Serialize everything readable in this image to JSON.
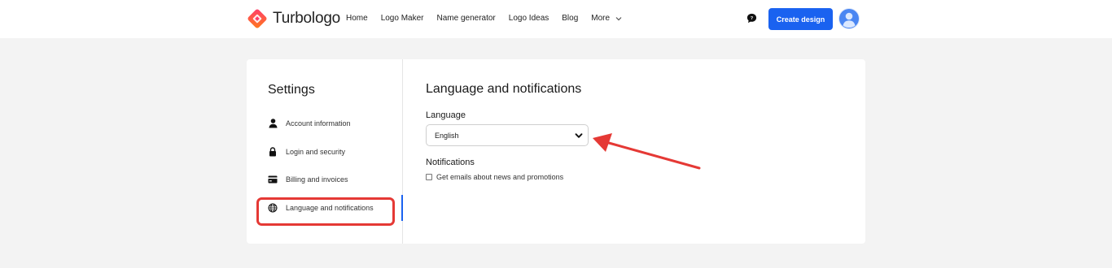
{
  "header": {
    "brand": "Turbologo",
    "nav": [
      {
        "label": "Home"
      },
      {
        "label": "Logo Maker"
      },
      {
        "label": "Name generator"
      },
      {
        "label": "Logo Ideas"
      },
      {
        "label": "Blog"
      },
      {
        "label": "More"
      }
    ],
    "create_button": "Create design",
    "icons": {
      "chat": "chat-bubble-icon",
      "avatar": "user-avatar-icon",
      "more": "chevron-down-icon"
    }
  },
  "settings": {
    "title": "Settings",
    "items": [
      {
        "label": "Account information",
        "icon": "user-icon"
      },
      {
        "label": "Login and security",
        "icon": "lock-icon"
      },
      {
        "label": "Billing and invoices",
        "icon": "credit-card-icon"
      },
      {
        "label": "Language and notifications",
        "icon": "globe-icon",
        "active": true
      }
    ]
  },
  "main": {
    "title": "Language and notifications",
    "language_label": "Language",
    "language_value": "English",
    "notifications_label": "Notifications",
    "checkbox_label": "Get emails about news and promotions",
    "checkbox_checked": false
  },
  "colors": {
    "accent": "#1a62f0",
    "annotation": "#e53935",
    "background": "#f3f3f3"
  }
}
